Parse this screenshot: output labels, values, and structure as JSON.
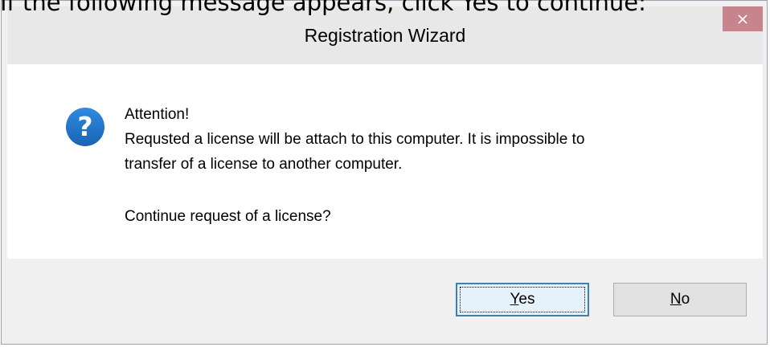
{
  "instruction": "If the following message appears, click Yes to continue:",
  "window": {
    "title": "Registration Wizard",
    "close_glyph": "×"
  },
  "icon": {
    "name": "question-icon",
    "glyph": "?",
    "color": "#1e74c6"
  },
  "message": {
    "heading": "Attention!",
    "line1": "Requsted a license will be attach to this computer. It is impossible to",
    "line2": "transfer of a license to another computer.",
    "question": "Continue request of a license?"
  },
  "buttons": {
    "yes": {
      "accel": "Y",
      "rest": "es"
    },
    "no": {
      "accel": "N",
      "rest": "o"
    }
  },
  "colors": {
    "close_button": "#c7848c",
    "default_button_border": "#3c7fb1"
  }
}
